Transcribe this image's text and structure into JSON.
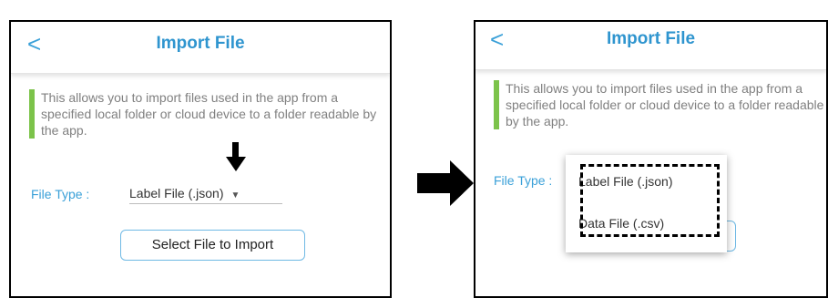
{
  "left": {
    "title": "Import File",
    "back_glyph": "<",
    "info_text": "This allows you to import files used in the app from a specified local folder or cloud device to a folder readable by the app.",
    "file_type_label": "File Type :",
    "dropdown_value": "Label File (.json)",
    "select_button_label": "Select File to Import"
  },
  "right": {
    "title": "Import File",
    "back_glyph": "<",
    "info_text": "This allows you to import files used in the app from a specified local folder or cloud device to a folder readable by the app.",
    "file_type_label": "File Type :",
    "options": [
      "Label File (.json)",
      "Data File (.csv)"
    ]
  },
  "icons": {
    "caret": "dropdown-caret-icon",
    "pointer": "down-arrow-icon",
    "transition": "right-arrow-icon"
  },
  "colors": {
    "accent": "#2f95cf",
    "info_bar": "#7cc34a",
    "button_border": "#6fb9e4"
  }
}
